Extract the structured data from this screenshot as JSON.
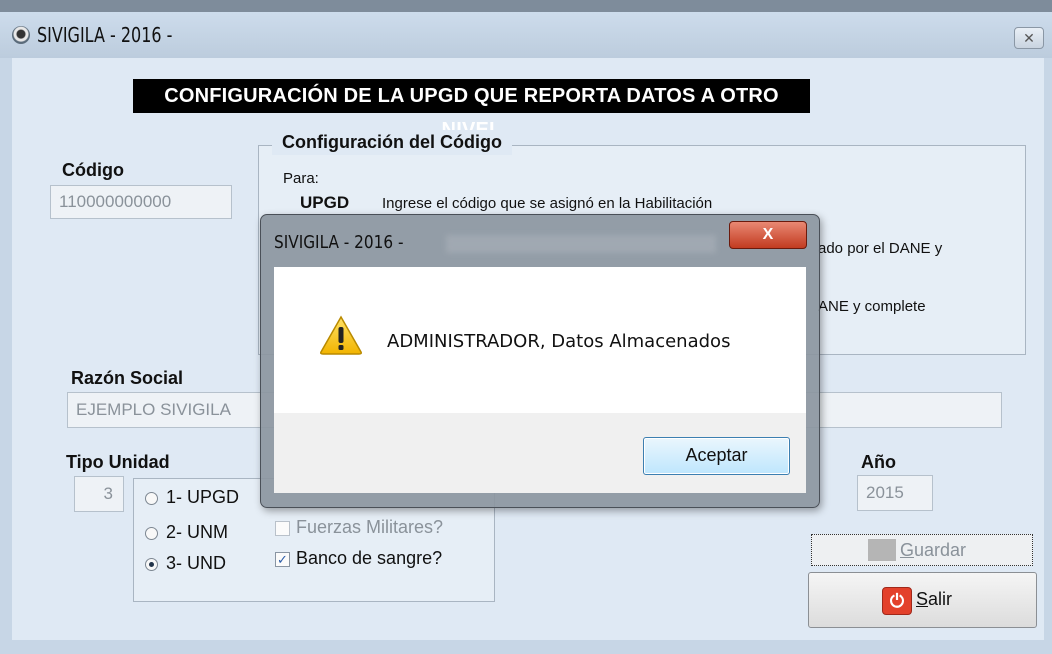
{
  "window": {
    "title": "SIVIGILA - 2016 -",
    "close_glyph": "✕"
  },
  "banner": "CONFIGURACIÓN DE LA UPGD QUE REPORTA DATOS A OTRO NIVEL",
  "codigo": {
    "label": "Código",
    "value": "110000000000"
  },
  "config": {
    "title": "Configuración del Código",
    "para": "Para:",
    "upgd_key": "UPGD",
    "upgd_text": "Ingrese el código que se asignó en la Habilitación",
    "line2_tail": "ado por el DANE y",
    "line3_tail": "ANE y complete"
  },
  "razon_social": {
    "label": "Razón Social",
    "value": "EJEMPLO SIVIGILA"
  },
  "tipo_unidad": {
    "label": "Tipo Unidad",
    "value": "3",
    "options": [
      {
        "label": "1- UPGD",
        "selected": false
      },
      {
        "label": "2- UNM",
        "selected": false
      },
      {
        "label": "3- UND",
        "selected": true
      }
    ],
    "checks": [
      {
        "label": "Fuerzas Militares?",
        "checked": false,
        "enabled": false
      },
      {
        "label": "Banco de sangre?",
        "checked": true,
        "enabled": true
      }
    ]
  },
  "anio": {
    "label": "Año",
    "value": "2015"
  },
  "buttons": {
    "guardar_first": "G",
    "guardar_rest": "uardar",
    "salir_first": "S",
    "salir_rest": "alir"
  },
  "dialog": {
    "title": "SIVIGILA - 2016 -",
    "close_glyph": "X",
    "message": "ADMINISTRADOR, Datos Almacenados",
    "ok_label": "Aceptar",
    "icon": "warning-icon"
  }
}
